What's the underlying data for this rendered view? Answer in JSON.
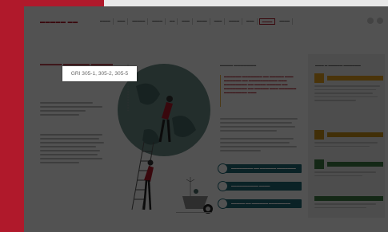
{
  "gri_tag": "GRI 305-1, 305-2, 305-5"
}
